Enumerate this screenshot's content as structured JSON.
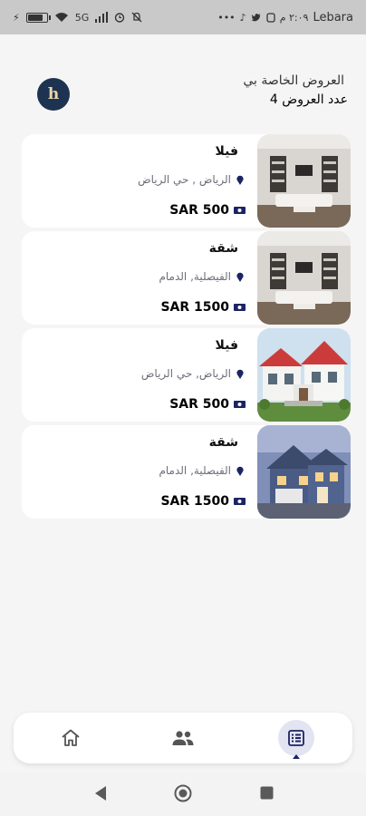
{
  "status_bar": {
    "carrier": "Lebara",
    "time": "٢:٠٩ م",
    "network": "5G"
  },
  "header": {
    "title": "العروض الخاصة بي",
    "count_label": "عدد العروض 4"
  },
  "listings": [
    {
      "title": "فيلا",
      "location": "الرياض , حي الرياض",
      "price": "SAR 500",
      "image": "interior-living-room"
    },
    {
      "title": "شقة",
      "location": "الفيصلية, الدمام",
      "price": "SAR 1500",
      "image": "interior-living-room"
    },
    {
      "title": "فيلا",
      "location": "الرياض, حي الرياض",
      "price": "SAR 500",
      "image": "white-house-red-roof"
    },
    {
      "title": "شقة",
      "location": "الفيصلية, الدمام",
      "price": "SAR 1500",
      "image": "blue-house-dusk"
    }
  ],
  "bottom_nav": {
    "items": [
      "home-icon",
      "people-icon",
      "list-icon"
    ],
    "active": "list-icon"
  },
  "colors": {
    "brand": "#1e3352",
    "accent": "#1c2463",
    "active_bg": "#e3e4f2"
  }
}
